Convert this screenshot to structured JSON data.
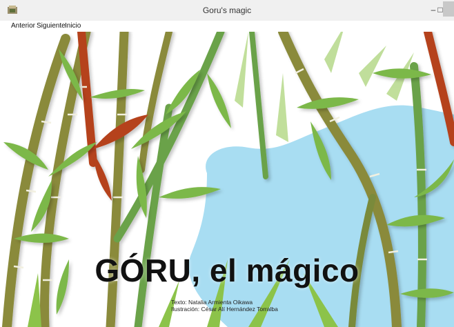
{
  "window": {
    "title": "Goru's magic",
    "controls": {
      "minimize": "–",
      "maximize": "□"
    }
  },
  "menu": [
    "Anterior",
    "Siguiente",
    "Inicio"
  ],
  "book": {
    "title_main": "GÓRU",
    "title_rest": ", el mágico",
    "credit_text": "Texto: Natalia Armienta Oikawa",
    "credit_illustration": "Ilustración: César Alí Hernández Torralba"
  },
  "colors": {
    "water": "#a8ddf2",
    "bamboo_olive": "#8a8a3a",
    "bamboo_green": "#6ba24a",
    "bamboo_red": "#b5431f",
    "leaf_green": "#7bb848"
  }
}
